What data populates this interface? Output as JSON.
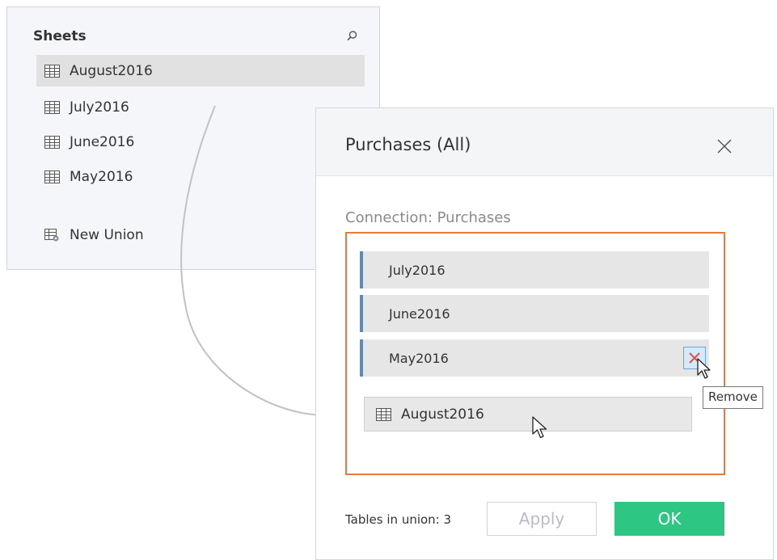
{
  "sheets_panel": {
    "title": "Sheets",
    "search_icon": "search-icon",
    "items": [
      {
        "label": "August2016",
        "icon": "table-icon",
        "selected": true
      },
      {
        "label": "July2016",
        "icon": "table-icon",
        "selected": false
      },
      {
        "label": "June2016",
        "icon": "table-icon",
        "selected": false
      },
      {
        "label": "May2016",
        "icon": "table-icon",
        "selected": false
      }
    ],
    "new_union": {
      "label": "New Union",
      "icon": "new-union-icon"
    }
  },
  "dialog": {
    "title": "Purchases (All)",
    "close_icon": "close-icon",
    "connection_label": "Connection: Purchases",
    "union_tables": [
      {
        "label": "July2016"
      },
      {
        "label": "June2016"
      },
      {
        "label": "May2016"
      }
    ],
    "remove_tooltip": "Remove",
    "dragged_table": {
      "label": "August2016",
      "icon": "table-icon"
    },
    "footer": {
      "tables_in_union": "Tables in union: 3",
      "apply_label": "Apply",
      "ok_label": "OK"
    }
  },
  "colors": {
    "drop_zone_border": "#e8793a",
    "row_accent": "#5b8db8",
    "ok_button": "#2ec683",
    "remove_x": "#d9534f"
  }
}
